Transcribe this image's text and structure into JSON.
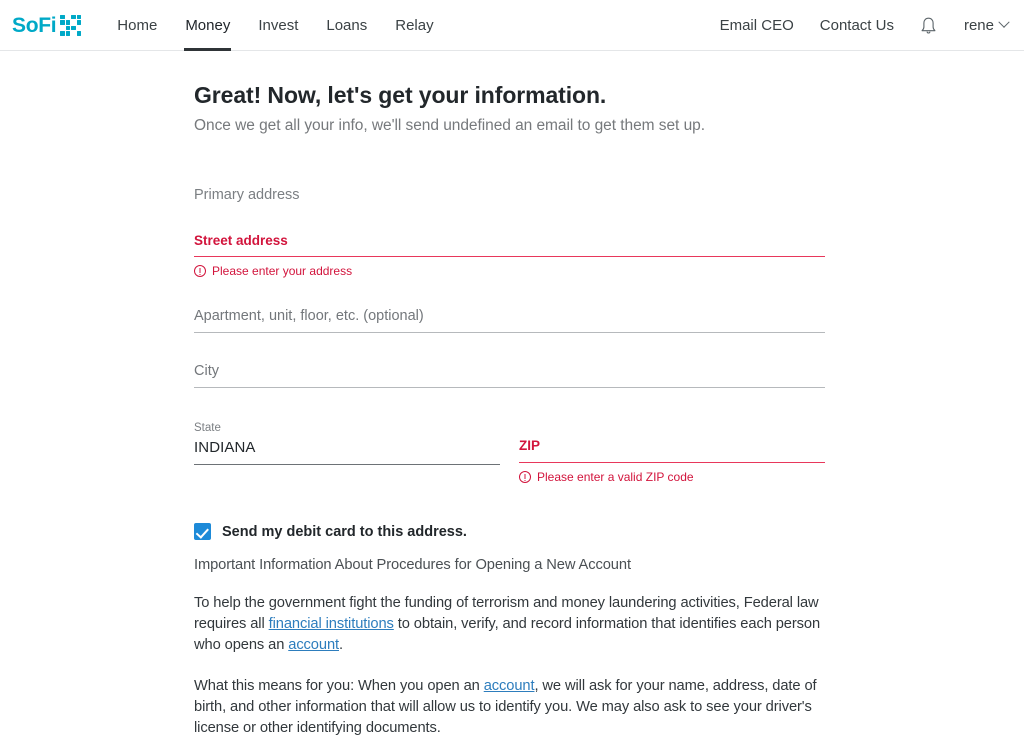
{
  "header": {
    "brand": {
      "text": "SoFi",
      "color": "#00a9c7",
      "icon": "sofi-grid-icon"
    },
    "nav": [
      {
        "label": "Home",
        "active": false
      },
      {
        "label": "Money",
        "active": true
      },
      {
        "label": "Invest",
        "active": false
      },
      {
        "label": "Loans",
        "active": false
      },
      {
        "label": "Relay",
        "active": false
      }
    ],
    "right_links": [
      {
        "label": "Email CEO"
      },
      {
        "label": "Contact Us"
      }
    ],
    "bell_icon": "notification-bell-icon",
    "user": {
      "name": "rene",
      "chevron": "chevron-down-icon"
    }
  },
  "main": {
    "title": "Great! Now, let's get your information.",
    "subtitle": "Once we get all your info, we'll send undefined an email to get them set up.",
    "section_label": "Primary address",
    "fields": {
      "street": {
        "label": "Street address",
        "value": "",
        "error": "Please enter your address",
        "has_error": true
      },
      "apartment": {
        "label": "Apartment, unit, floor, etc. (optional)",
        "value": "",
        "has_error": false
      },
      "city": {
        "label": "City",
        "value": "",
        "has_error": false
      },
      "state": {
        "label": "State",
        "value": "INDIANA",
        "has_error": false
      },
      "zip": {
        "label": "ZIP",
        "value": "",
        "error": "Please enter a valid ZIP code",
        "has_error": true
      }
    },
    "checkbox": {
      "label": "Send my debit card to this address.",
      "checked": true,
      "color": "#1d8ad8"
    },
    "disclosure": {
      "title": "Important Information About Procedures for Opening a New Account",
      "p1_a": "To help the government fight the funding of terrorism and money laundering activities, Federal law requires all ",
      "p1_link1": "financial institutions",
      "p1_b": " to obtain, verify, and record information that identifies each person who opens an ",
      "p1_link2": "account",
      "p1_c": ".",
      "p2_a": "What this means for you: When you open an ",
      "p2_link1": "account",
      "p2_b": ", we will ask for your name, address, date of birth, and other information that will allow us to identify you. We may also ask to see your driver's license or other identifying documents."
    }
  },
  "colors": {
    "brand": "#00a9c7",
    "error": "#d2143c",
    "link": "#2d7dbd",
    "checkbox": "#1d8ad8"
  }
}
